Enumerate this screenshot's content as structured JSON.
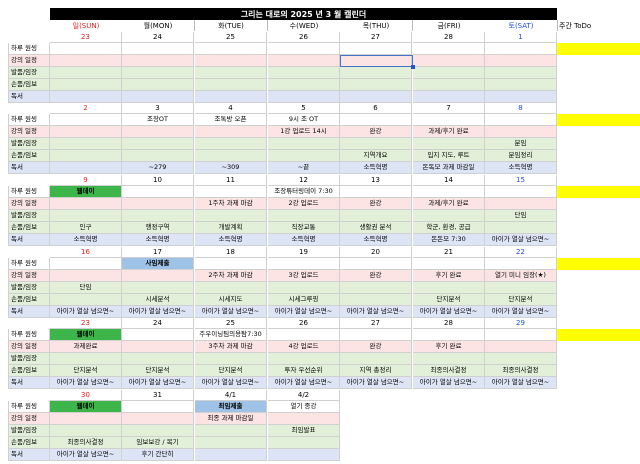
{
  "title": "그리는 대로의 2025 년 3 월 캘린더",
  "headers": [
    "일(SUN)",
    "월(MON)",
    "화(TUE)",
    "수(WED)",
    "목(THU)",
    "금(FRI)",
    "토(SAT)"
  ],
  "todo_label": "주간 ToDo",
  "row_labels": [
    "하루 원씽",
    "강의 일정",
    "발품/임장",
    "손품/임보",
    "독서"
  ],
  "colors": {
    "green": "#3db54a",
    "blue": "#9ec3e6",
    "yellow": "#ffff00",
    "row1": "#ffffff",
    "row2": "#fce4e4",
    "row3": "#e2f0d9",
    "row4": "#e2f0d9",
    "row5": "#dce4f5",
    "sun": "#e02020",
    "sat": "#2050e0"
  },
  "weeks": [
    {
      "dates": [
        "23",
        "24",
        "25",
        "26",
        "27",
        "28",
        "1"
      ],
      "rows": [
        [
          "",
          "",
          "",
          "",
          "",
          "",
          ""
        ],
        [
          "",
          "",
          "",
          "",
          "",
          "",
          ""
        ],
        [
          "",
          "",
          "",
          "",
          "",
          "",
          ""
        ],
        [
          "",
          "",
          "",
          "",
          "",
          "",
          ""
        ],
        [
          "",
          "",
          "",
          "",
          "",
          "",
          ""
        ]
      ],
      "green": [],
      "blue": []
    },
    {
      "dates": [
        "2",
        "3",
        "4",
        "5",
        "6",
        "7",
        "8"
      ],
      "rows": [
        [
          "",
          "조장OT",
          "조톡방 오픈",
          "9시 조 OT",
          "",
          "",
          ""
        ],
        [
          "",
          "",
          "",
          "1강 업로드 14시",
          "완강",
          "과제/후기 완료",
          ""
        ],
        [
          "",
          "",
          "",
          "",
          "",
          "",
          "분임"
        ],
        [
          "",
          "",
          "",
          "",
          "지역개요",
          "입지 지도, 루트",
          "분임정리"
        ],
        [
          "",
          "~279",
          "~309",
          "~끝",
          "소득혁명",
          "돈독모 과제 마감일",
          "소득혁명"
        ]
      ],
      "green": [],
      "blue": []
    },
    {
      "dates": [
        "9",
        "10",
        "11",
        "12",
        "13",
        "14",
        "15"
      ],
      "rows": [
        [
          "웹데이",
          "",
          "",
          "조장튜터링데이 7:30",
          "",
          "",
          ""
        ],
        [
          "",
          "",
          "1주차 과제 마감",
          "2강 업로드",
          "완강",
          "과제/후기 완료",
          ""
        ],
        [
          "",
          "",
          "",
          "",
          "",
          "",
          "단임"
        ],
        [
          "인구",
          "행정구역",
          "개발계획",
          "직장교통",
          "생활권 분석",
          "학군, 환경, 공급",
          ""
        ],
        [
          "소득혁명",
          "소득혁명",
          "소득혁명",
          "소득혁명",
          "소득혁명",
          "돈돈모 7:30",
          "아이가 열살 넘으면~"
        ]
      ],
      "green": [
        0
      ],
      "blue": []
    },
    {
      "dates": [
        "16",
        "17",
        "18",
        "19",
        "20",
        "21",
        "22"
      ],
      "rows": [
        [
          "",
          "사임제출",
          "",
          "",
          "",
          "",
          ""
        ],
        [
          "",
          "",
          "2주차 과제 마감",
          "3강 업로드",
          "완강",
          "후기 완료",
          "열기 미니 임장(★)"
        ],
        [
          "단임",
          "",
          "",
          "",
          "",
          "",
          ""
        ],
        [
          "",
          "시세분석",
          "시세지도",
          "시세그루핑",
          "",
          "단지분석",
          "단지분석"
        ],
        [
          "아이가 열살 넘으면~",
          "아이가 열살 넘으면~",
          "아이가 열살 넘으면~",
          "아이가 열살 넘으면~",
          "아이가 열살 넘으면~",
          "아이가 열살 넘으면~",
          "아이가 열살 넘으면~"
        ]
      ],
      "green": [],
      "blue": [
        1
      ]
    },
    {
      "dates": [
        "23",
        "24",
        "25",
        "26",
        "27",
        "28",
        "29"
      ],
      "rows": [
        [
          "웹데이",
          "",
          "주우이닝팀의용탐7:30",
          "",
          "",
          "",
          ""
        ],
        [
          "과제완료",
          "",
          "3주차 과제 마감",
          "4강 업로드",
          "완강",
          "후기 완료",
          ""
        ],
        [
          "",
          "",
          "",
          "",
          "",
          "",
          ""
        ],
        [
          "단지분석",
          "단지분석",
          "단지분석",
          "투자 우선순위",
          "지역 총정리",
          "최종의사결정",
          "최종의사결정"
        ],
        [
          "아이가 열살 넘으면~",
          "아이가 열살 넘으면~",
          "아이가 열살 넘으면~",
          "아이가 열살 넘으면~",
          "아이가 열살 넘으면~",
          "아이가 열살 넘으면~",
          "아이가 열살 넘으면~"
        ]
      ],
      "green": [
        0
      ],
      "blue": []
    },
    {
      "dates": [
        "30",
        "31",
        "4/1",
        "4/2"
      ],
      "rows": [
        [
          "웹데이",
          "",
          "최임제출",
          "열기 중강"
        ],
        [
          "",
          "",
          "최종 과제 마감일",
          ""
        ],
        [
          "",
          "",
          "",
          "최임발표"
        ],
        [
          "최종의사결정",
          "임보보강 / 복기",
          "",
          ""
        ],
        [
          "아이가 열살 넘으면~",
          "후기 간단히",
          "",
          ""
        ]
      ],
      "green": [
        0
      ],
      "blue": [
        2
      ]
    }
  ]
}
